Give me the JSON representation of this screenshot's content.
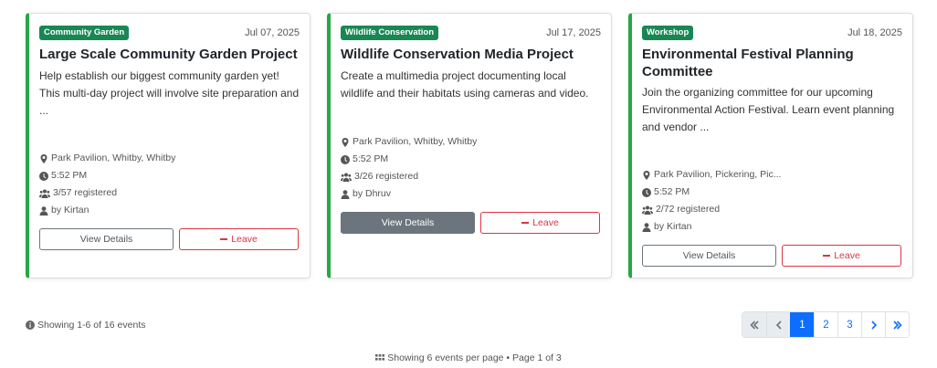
{
  "cards": [
    {
      "badge": "Community Garden",
      "date": "Jul 07, 2025",
      "title": "Large Scale Community Garden Project",
      "description": "Help establish our biggest community garden yet! This multi-day project will involve site preparation and ...",
      "location": "Park Pavilion, Whitby, Whitby",
      "time": "5:52 PM",
      "registered": "3/57 registered",
      "organizer": "by Kirtan",
      "view_label": "View Details",
      "leave_label": "Leave"
    },
    {
      "badge": "Wildlife Conservation",
      "date": "Jul 17, 2025",
      "title": "Wildlife Conservation Media Project",
      "description": "Create a multimedia project documenting local wildlife and their habitats using cameras and video.",
      "location": "Park Pavilion, Whitby, Whitby",
      "time": "5:52 PM",
      "registered": "3/26 registered",
      "organizer": "by Dhruv",
      "view_label": "View Details",
      "leave_label": "Leave"
    },
    {
      "badge": "Workshop",
      "date": "Jul 18, 2025",
      "title": "Environmental Festival Planning Committee",
      "description": "Join the organizing committee for our upcoming Environmental Action Festival. Learn event planning and vendor ...",
      "location": "Park Pavilion, Pickering, Pic...",
      "time": "5:52 PM",
      "registered": "2/72 registered",
      "organizer": "by Kirtan",
      "view_label": "View Details",
      "leave_label": "Leave"
    }
  ],
  "showing_text": "Showing 1-6 of 16 events",
  "pagination": {
    "pages": [
      "1",
      "2",
      "3"
    ],
    "active_page": "1"
  },
  "footer_text": "Showing 6 events per page • Page 1 of 3",
  "colors": {
    "card_accent": "#28a745",
    "badge": "#198754",
    "primary": "#0d6efd",
    "danger": "#dc3545",
    "secondary": "#6c757d"
  },
  "icons": [
    "map-marker-icon",
    "clock-icon",
    "users-icon",
    "user-icon",
    "minus-icon",
    "info-icon",
    "grid-icon",
    "double-chevron-left-icon",
    "chevron-left-icon",
    "chevron-right-icon",
    "double-chevron-right-icon"
  ]
}
